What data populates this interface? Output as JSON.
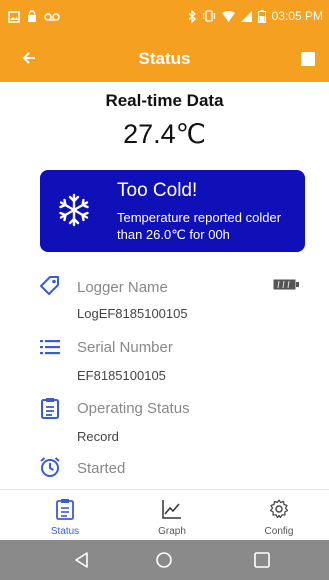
{
  "status_bar": {
    "time": "03:05 PM"
  },
  "app_bar": {
    "title": "Status",
    "back_icon": "back-arrow-icon",
    "menu_icon": "stop-square-icon"
  },
  "realtime": {
    "title": "Real-time Data",
    "temperature": "27.4℃"
  },
  "alert": {
    "title": "Too Cold!",
    "message": "Temperature reported colder than 26.0℃ for 00h",
    "color": "#1010b8",
    "icon": "snowflake-icon"
  },
  "details": [
    {
      "label": "Logger Name",
      "value": "LogEF8185100105",
      "icon": "tag-icon"
    },
    {
      "label": "Serial Number",
      "value": "EF8185100105",
      "icon": "list-icon"
    },
    {
      "label": "Operating Status",
      "value": "Record",
      "icon": "clipboard-icon"
    },
    {
      "label": "Started",
      "value": "",
      "icon": "alarm-clock-icon"
    }
  ],
  "tabs": [
    {
      "label": "Status",
      "icon": "clipboard-icon",
      "active": true
    },
    {
      "label": "Graph",
      "icon": "line-graph-icon",
      "active": false
    },
    {
      "label": "Config",
      "icon": "gear-icon",
      "active": false
    }
  ],
  "colors": {
    "accent": "#f5a020",
    "alert_bg": "#1010b8",
    "icon_blue": "#3b5bd6",
    "nav_bar": "#8a8a8a"
  }
}
